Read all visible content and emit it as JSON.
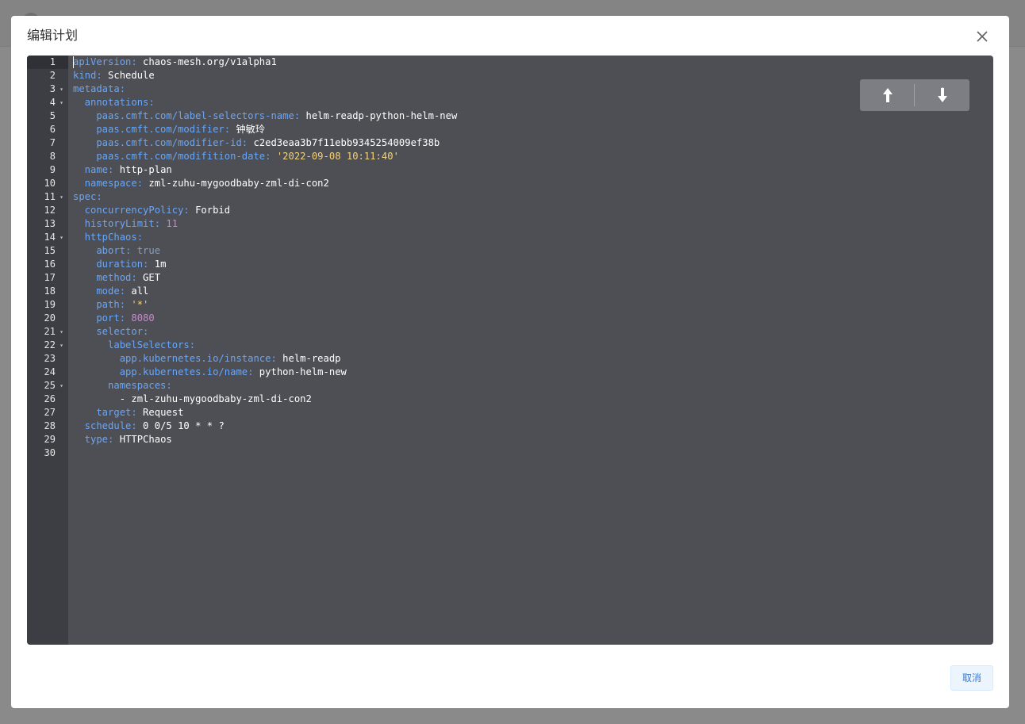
{
  "dialog": {
    "title": "编辑计划",
    "cancel_label": "取消"
  },
  "editor": {
    "line_numbers": [
      "1",
      "2",
      "3",
      "4",
      "5",
      "6",
      "7",
      "8",
      "9",
      "10",
      "11",
      "12",
      "13",
      "14",
      "15",
      "16",
      "17",
      "18",
      "19",
      "20",
      "21",
      "22",
      "23",
      "24",
      "25",
      "26",
      "27",
      "28",
      "29",
      "30"
    ],
    "foldable_lines": [
      3,
      4,
      11,
      14,
      21,
      22,
      25
    ],
    "lines": [
      [
        {
          "t": "apiVersion:",
          "c": "k"
        },
        {
          "t": " chaos-mesh.org/v1alpha1",
          "c": "v"
        }
      ],
      [
        {
          "t": "kind:",
          "c": "k"
        },
        {
          "t": " Schedule",
          "c": "v"
        }
      ],
      [
        {
          "t": "metadata:",
          "c": "k"
        }
      ],
      [
        {
          "t": "  annotations:",
          "c": "k"
        }
      ],
      [
        {
          "t": "    paas.cmft.com/label-selectors-name:",
          "c": "k"
        },
        {
          "t": " helm-readp-python-helm-new",
          "c": "v"
        }
      ],
      [
        {
          "t": "    paas.cmft.com/modifier:",
          "c": "k"
        },
        {
          "t": " 钟敏玲",
          "c": "v"
        }
      ],
      [
        {
          "t": "    paas.cmft.com/modifier-id:",
          "c": "k"
        },
        {
          "t": " c2ed3eaa3b7f11ebb9345254009ef38b",
          "c": "v"
        }
      ],
      [
        {
          "t": "    paas.cmft.com/modifition-date:",
          "c": "k"
        },
        {
          "t": " '2022-09-08 10:11:40'",
          "c": "s"
        }
      ],
      [
        {
          "t": "  name:",
          "c": "k"
        },
        {
          "t": " http-plan",
          "c": "v"
        }
      ],
      [
        {
          "t": "  namespace:",
          "c": "k"
        },
        {
          "t": " zml-zuhu-mygoodbaby-zml-di-con2",
          "c": "v"
        }
      ],
      [
        {
          "t": "spec:",
          "c": "k"
        }
      ],
      [
        {
          "t": "  concurrencyPolicy:",
          "c": "k"
        },
        {
          "t": " Forbid",
          "c": "v"
        }
      ],
      [
        {
          "t": "  historyLimit:",
          "c": "k"
        },
        {
          "t": " 11",
          "c": "n"
        }
      ],
      [
        {
          "t": "  httpChaos:",
          "c": "k"
        }
      ],
      [
        {
          "t": "    abort:",
          "c": "k"
        },
        {
          "t": " true",
          "c": "b"
        }
      ],
      [
        {
          "t": "    duration:",
          "c": "k"
        },
        {
          "t": " 1m",
          "c": "v"
        }
      ],
      [
        {
          "t": "    method:",
          "c": "k"
        },
        {
          "t": " GET",
          "c": "v"
        }
      ],
      [
        {
          "t": "    mode:",
          "c": "k"
        },
        {
          "t": " all",
          "c": "v"
        }
      ],
      [
        {
          "t": "    path:",
          "c": "k"
        },
        {
          "t": " '*'",
          "c": "s"
        }
      ],
      [
        {
          "t": "    port:",
          "c": "k"
        },
        {
          "t": " 8080",
          "c": "n"
        }
      ],
      [
        {
          "t": "    selector:",
          "c": "k"
        }
      ],
      [
        {
          "t": "      labelSelectors:",
          "c": "k"
        }
      ],
      [
        {
          "t": "        app.kubernetes.io/instance:",
          "c": "k"
        },
        {
          "t": " helm-readp",
          "c": "v"
        }
      ],
      [
        {
          "t": "        app.kubernetes.io/name:",
          "c": "k"
        },
        {
          "t": " python-helm-new",
          "c": "v"
        }
      ],
      [
        {
          "t": "      namespaces:",
          "c": "k"
        }
      ],
      [
        {
          "t": "        - zml-zuhu-mygoodbaby-zml-di-con2",
          "c": "v"
        }
      ],
      [
        {
          "t": "    target:",
          "c": "k"
        },
        {
          "t": " Request",
          "c": "v"
        }
      ],
      [
        {
          "t": "  schedule:",
          "c": "k"
        },
        {
          "t": " 0 0/5 10 * * ?",
          "c": "v"
        }
      ],
      [
        {
          "t": "  type:",
          "c": "k"
        },
        {
          "t": " HTTPChaos",
          "c": "v"
        }
      ],
      []
    ]
  },
  "colors": {
    "key": "#6aa6f5",
    "value": "#ffffff",
    "string": "#f2d27a",
    "number": "#c38bc7",
    "boolean": "#8b9dba",
    "editor_bg": "#4d4f55",
    "gutter_bg": "#3c3e44"
  },
  "icons": {
    "close": "close-icon",
    "scroll_up": "arrow-up-icon",
    "scroll_down": "arrow-down-icon",
    "fold": "fold-triangle-icon"
  }
}
